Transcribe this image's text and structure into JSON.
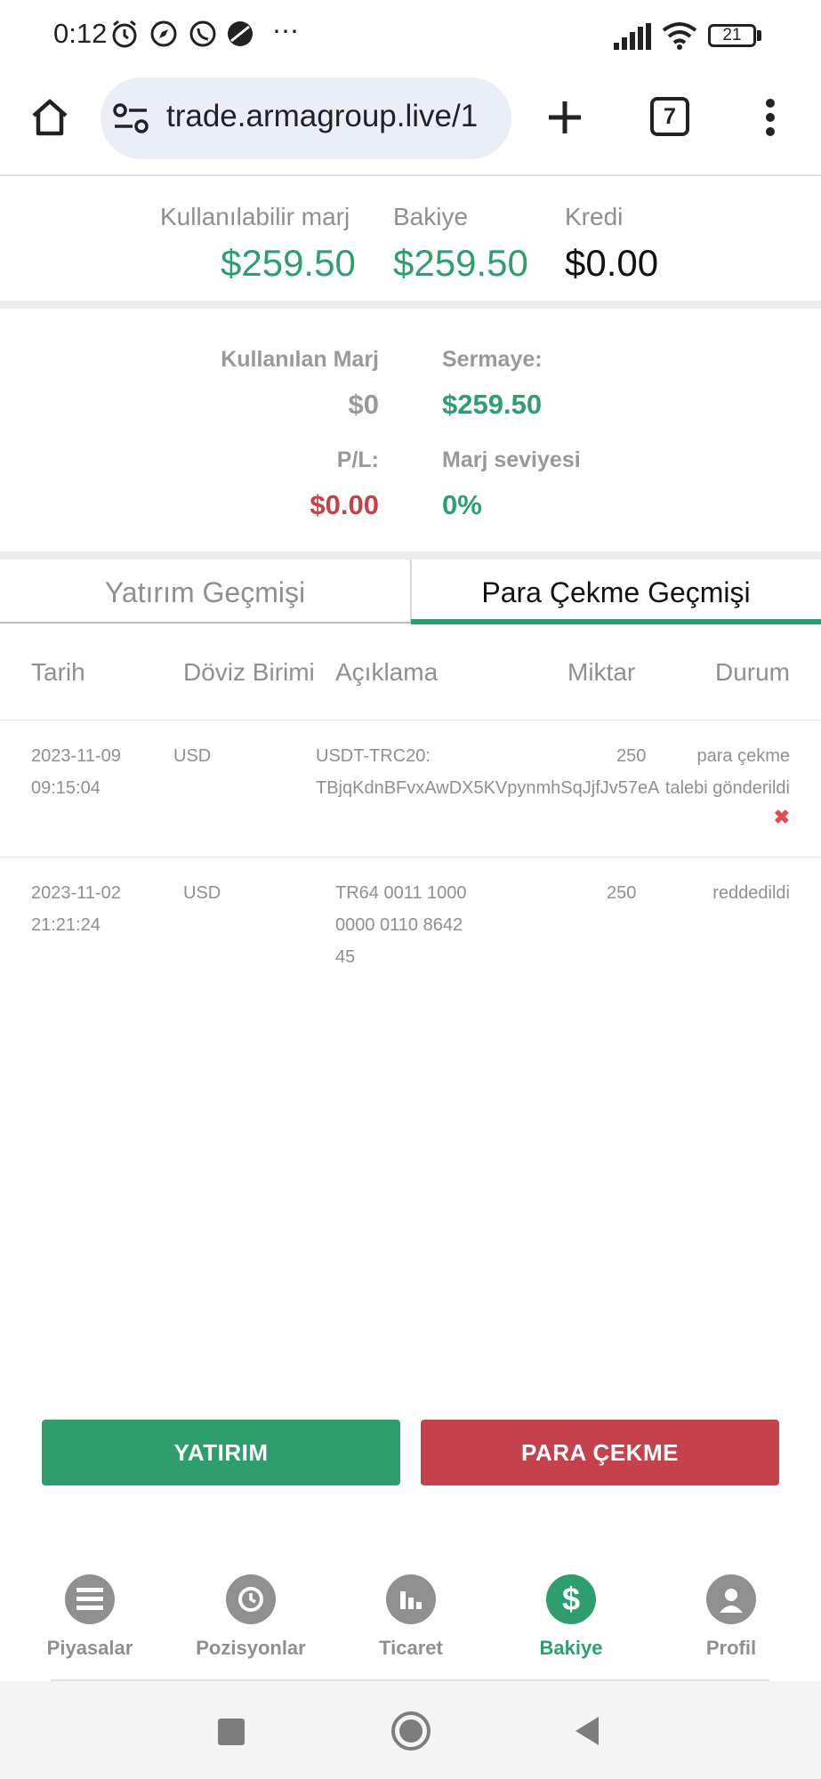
{
  "status_bar": {
    "time": "0:12",
    "battery": "21"
  },
  "browser": {
    "url": "trade.armagroup.live/1",
    "tab_count": "7"
  },
  "summary": {
    "available_margin_label": "Kullanılabilir marj",
    "available_margin_value": "$259.50",
    "balance_label": "Bakiye",
    "balance_value": "$259.50",
    "credit_label": "Kredi",
    "credit_value": "$0.00"
  },
  "margin": {
    "used_margin_label": "Kullanılan Marj",
    "used_margin_value": "$0",
    "equity_label": "Sermaye:",
    "equity_value": "$259.50",
    "pl_label": "P/L:",
    "pl_value": "$0.00",
    "margin_level_label": "Marj seviyesi",
    "margin_level_value": "0%"
  },
  "tabs": [
    {
      "label": "Yatırım Geçmişi",
      "active": false
    },
    {
      "label": "Para Çekme Geçmişi",
      "active": true
    }
  ],
  "table": {
    "headers": [
      "Tarih",
      "Döviz Birimi",
      "Açıklama",
      "Miktar",
      "Durum"
    ],
    "rows": [
      {
        "date": "2023-11-09",
        "time": "09:15:04",
        "currency": "USD",
        "desc_line1": "USDT-TRC20:",
        "desc_line2": "TBjqKdnBFvxAwDX5KVpynmhSqJjfJv57eA",
        "amount": "250",
        "status_line1": "para çekme",
        "status_line2": "talebi gönderildi"
      },
      {
        "date": "2023-11-02",
        "time": "21:21:24",
        "currency": "USD",
        "desc_line1": "TR64 0011 1000",
        "desc_line2": "0000 0110 8642",
        "desc_line3": "45",
        "amount": "250",
        "status_line1": "reddedildi"
      }
    ]
  },
  "buttons": {
    "deposit": "YATIRIM",
    "withdraw": "PARA ÇEKME"
  },
  "bottom_nav": [
    {
      "label": "Piyasalar",
      "icon": "list-icon"
    },
    {
      "label": "Pozisyonlar",
      "icon": "history-icon"
    },
    {
      "label": "Ticaret",
      "icon": "bar-chart-icon"
    },
    {
      "label": "Bakiye",
      "icon": "dollar-icon",
      "active": true
    },
    {
      "label": "Profil",
      "icon": "user-icon"
    }
  ],
  "colors": {
    "green": "#2e9e6f",
    "red": "#c5414b",
    "gray": "#8f8f8f"
  }
}
